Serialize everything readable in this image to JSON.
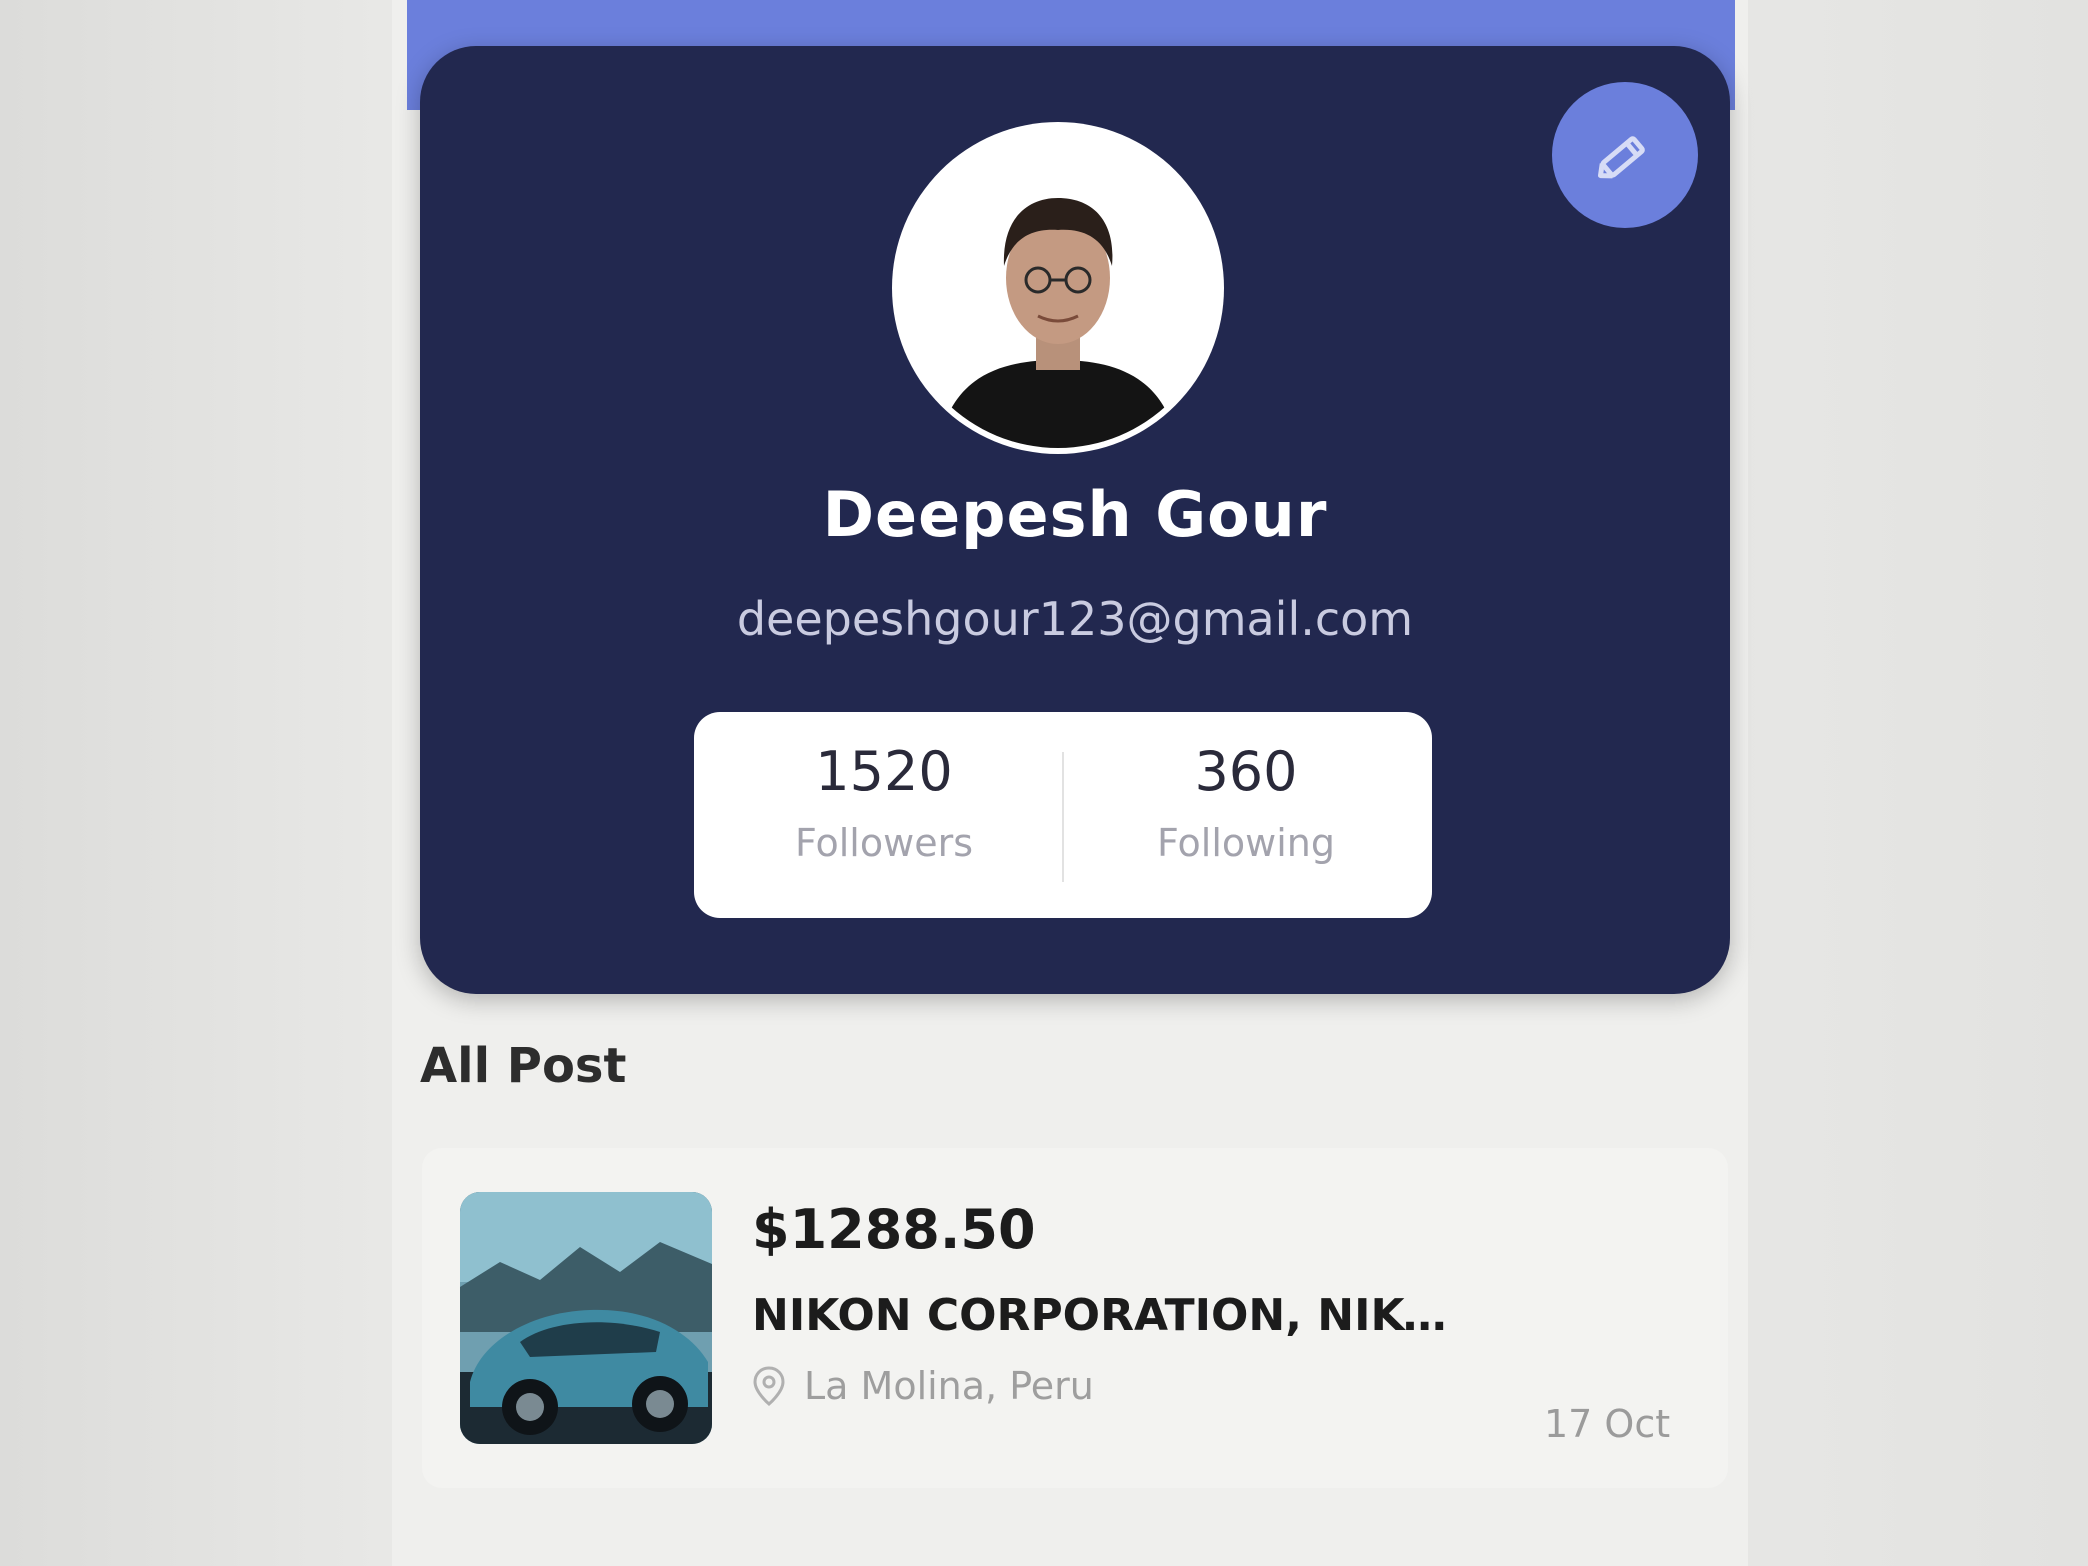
{
  "profile": {
    "name": "Deepesh Gour",
    "email": "deepeshgour123@gmail.com",
    "edit_icon": "pencil-icon",
    "avatar_icon": "user-photo"
  },
  "stats": {
    "followers_value": "1520",
    "followers_label": "Followers",
    "following_value": "360",
    "following_label": "Following"
  },
  "posts_section": {
    "title": "All Post",
    "items": [
      {
        "price": "$1288.50",
        "title": "NIKON CORPORATION, NIKO...",
        "location": "La Molina, Peru",
        "date": "17 Oct",
        "location_icon": "location-pin-icon"
      }
    ]
  },
  "colors": {
    "accent": "#6b7fdc",
    "card_background": "#22284f"
  }
}
